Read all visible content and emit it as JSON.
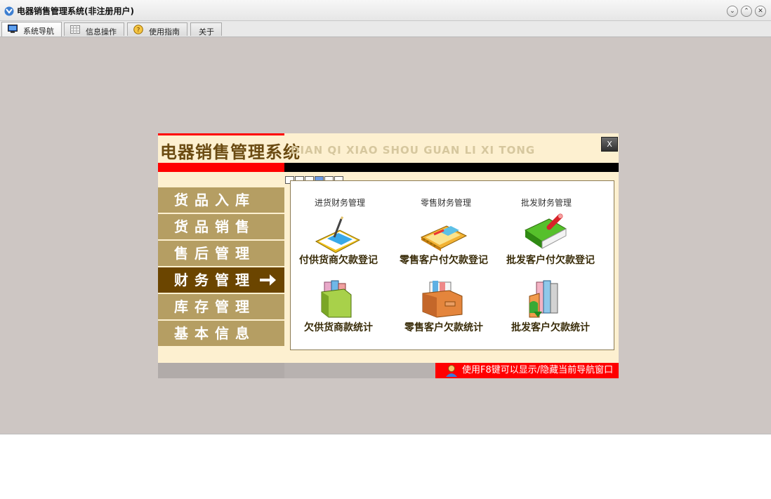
{
  "window": {
    "title": "电器销售管理系统(非注册用户)",
    "controls": [
      "⌄",
      "⌃",
      "✕"
    ]
  },
  "tabs": [
    {
      "label": "系统导航",
      "icon": "monitor-icon",
      "active": true
    },
    {
      "label": "信息操作",
      "icon": "grid-icon",
      "active": false
    },
    {
      "label": "使用指南",
      "icon": "help-icon",
      "active": false
    },
    {
      "label": "关于",
      "icon": "",
      "active": false
    }
  ],
  "panel": {
    "title": "电器销售管理系统",
    "pinyin": "DIAN QI XIAO SHOU GUAN LI XI TONG",
    "close_label": "X",
    "menu": [
      {
        "label": "货品入库",
        "active": false
      },
      {
        "label": "货品销售",
        "active": false
      },
      {
        "label": "售后管理",
        "active": false
      },
      {
        "label": "财务管理",
        "active": true
      },
      {
        "label": "库存管理",
        "active": false
      },
      {
        "label": "基本信息",
        "active": false
      }
    ],
    "page_tabs": 6,
    "active_page_tab": 3,
    "categories": [
      "进货财务管理",
      "零售财务管理",
      "批发财务管理"
    ],
    "items": [
      {
        "label": "付供货商欠款登记",
        "icon": "notebook-pen-icon"
      },
      {
        "label": "零售客户付欠款登记",
        "icon": "spiral-notebook-icon"
      },
      {
        "label": "批发客户付欠款登记",
        "icon": "green-book-icon"
      },
      {
        "label": "欠供货商款统计",
        "icon": "file-holder-icon"
      },
      {
        "label": "零售客户欠款统计",
        "icon": "file-box-icon"
      },
      {
        "label": "批发客户欠款统计",
        "icon": "book-stack-icon"
      }
    ],
    "footer_tip": "使用F8键可以显示/隐藏当前导航窗口"
  }
}
